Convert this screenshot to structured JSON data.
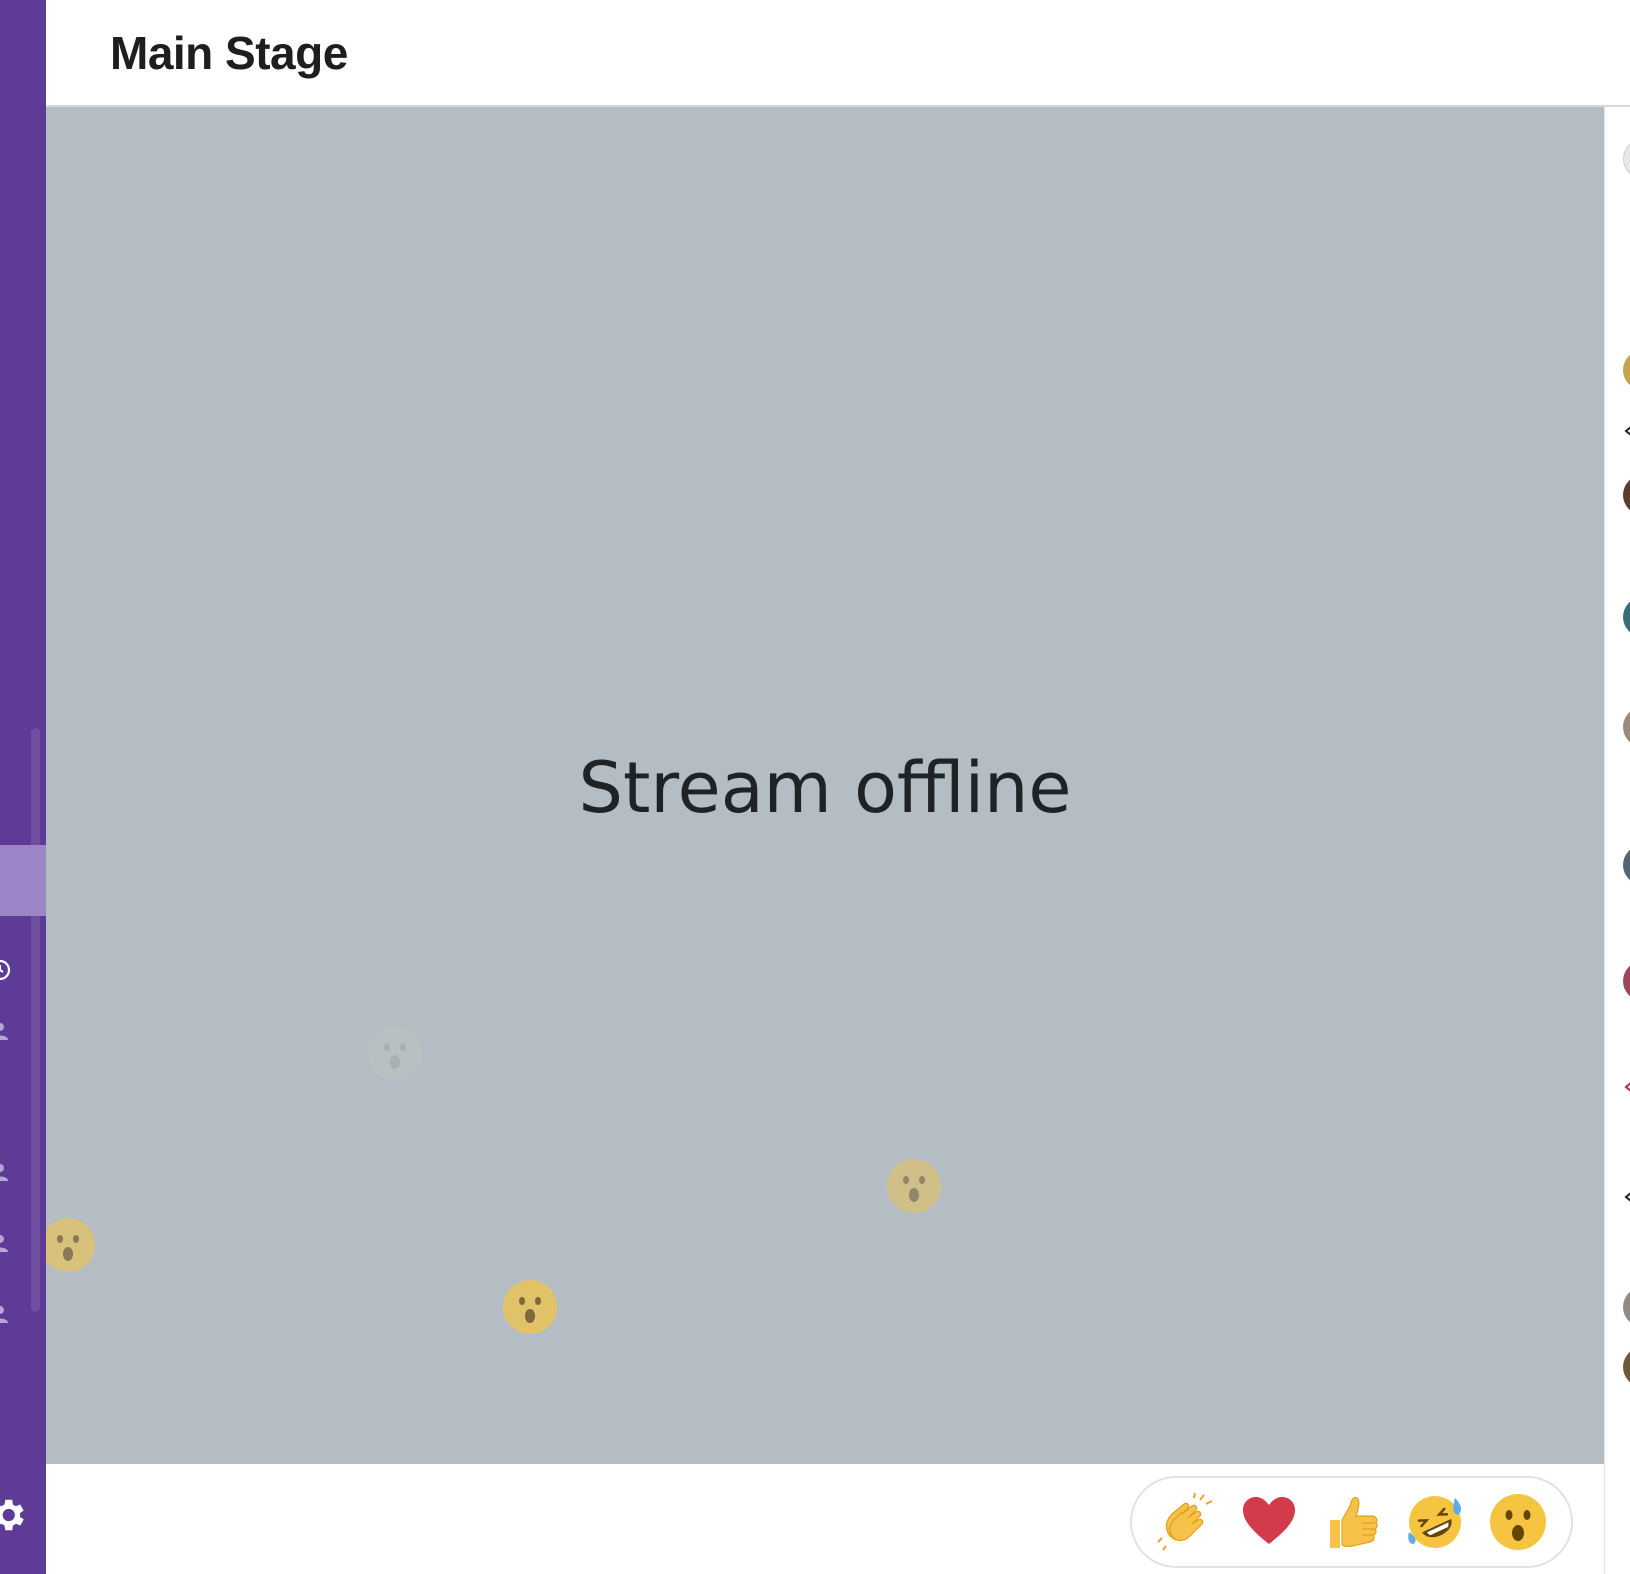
{
  "header": {
    "title": "Main Stage"
  },
  "stage": {
    "status_text": "Stream offline"
  },
  "reactions": [
    {
      "name": "clap",
      "icon": "clapping-hands-icon"
    },
    {
      "name": "heart",
      "icon": "heart-icon"
    },
    {
      "name": "thumbs-up",
      "icon": "thumbs-up-icon"
    },
    {
      "name": "laugh",
      "icon": "rolling-laughing-icon"
    },
    {
      "name": "wow",
      "icon": "surprised-face-icon"
    }
  ],
  "floating_reactions": [
    {
      "icon": "surprised-face-icon",
      "opacity": 0.25
    },
    {
      "icon": "surprised-face-icon",
      "opacity": 0.45
    },
    {
      "icon": "surprised-face-icon",
      "opacity": 0.55
    },
    {
      "icon": "surprised-face-icon",
      "opacity": 0.7
    }
  ],
  "colors": {
    "sidebar": "#5e3b97",
    "sidebar_active": "#9c86c7",
    "stage_background": "#b3bdc3",
    "emoji_yellow": "#f5c542",
    "heart_red": "#d23b49"
  }
}
